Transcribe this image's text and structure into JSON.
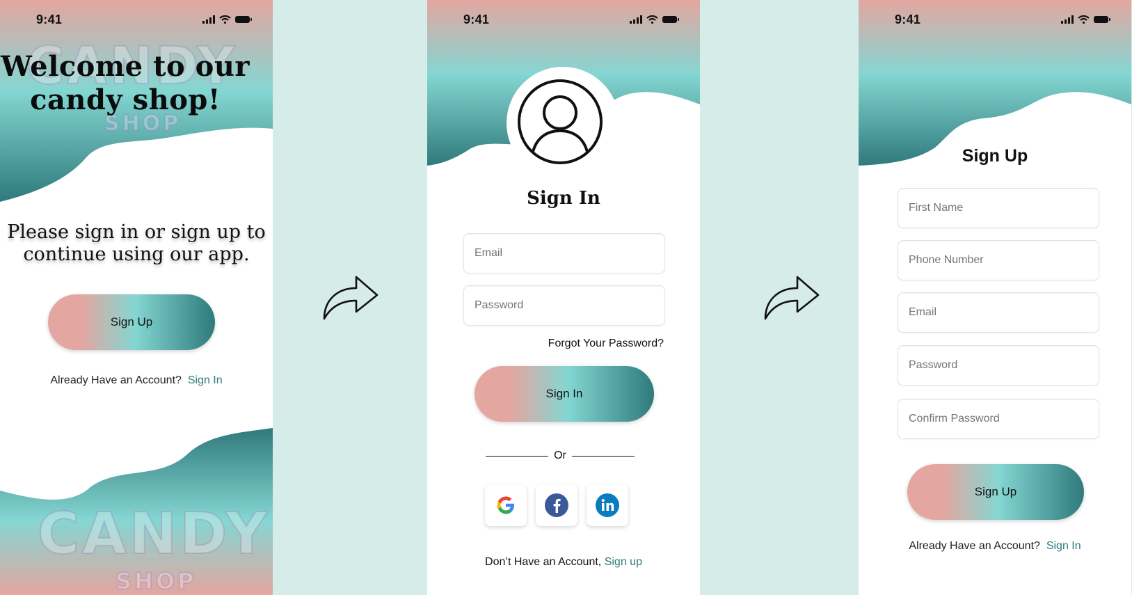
{
  "status": {
    "time": "9:41"
  },
  "welcome": {
    "title_line1": "Welcome to our",
    "title_line2": "candy shop!",
    "subtitle_line1": "Please sign in or sign up to",
    "subtitle_line2": "continue using our app.",
    "signup_button": "Sign Up",
    "already_text": "Already Have an Account?",
    "signin_link": "Sign In",
    "watermark_top": "CANDY",
    "watermark_top_shop": "SHOP",
    "watermark_bottom": "CANDY",
    "watermark_bottom_shop": "SHOP"
  },
  "signin": {
    "title": "Sign In",
    "email_placeholder": "Email",
    "password_placeholder": "Password",
    "forgot": "Forgot Your Password?",
    "button": "Sign In",
    "or": "Or",
    "social": [
      "google-icon",
      "facebook-icon",
      "linkedin-icon"
    ],
    "no_account_text": "Don’t Have an Account,",
    "signup_link": "Sign up"
  },
  "signup": {
    "title": "Sign Up",
    "first_name_placeholder": "First Name",
    "phone_placeholder": "Phone Number",
    "email_placeholder": "Email",
    "password_placeholder": "Password",
    "confirm_placeholder": "Confirm Password",
    "button": "Sign Up",
    "already_text": "Already Have an Account?",
    "signin_link": "Sign In"
  },
  "colors": {
    "background": "#d5ece8",
    "pink": "#e4a6a0",
    "teal_light": "#84d6d2",
    "teal_dark": "#2f7a7c",
    "link": "#2e7a80"
  }
}
